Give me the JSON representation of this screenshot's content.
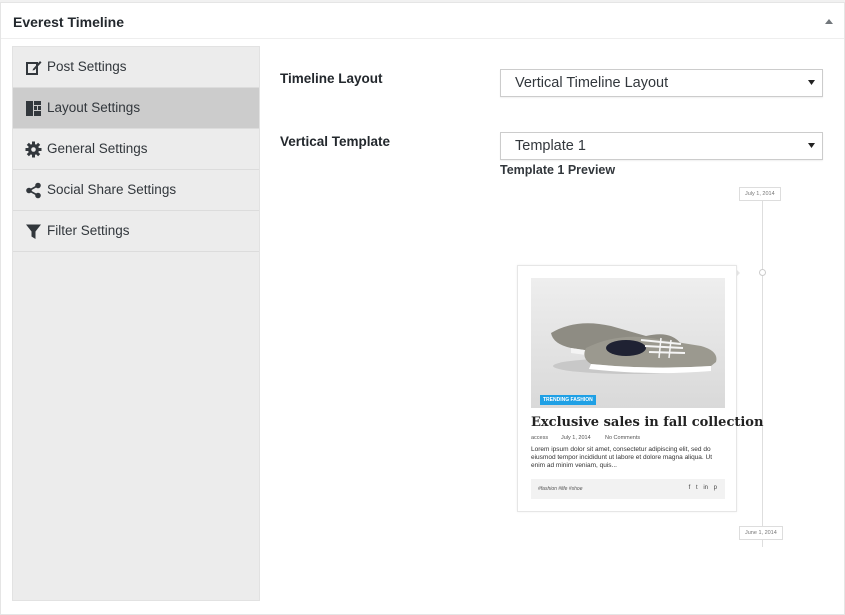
{
  "metabox": {
    "title": "Everest Timeline"
  },
  "sidebar": {
    "items": [
      {
        "label": "Post Settings",
        "icon": "edit-icon"
      },
      {
        "label": "Layout Settings",
        "icon": "layout-icon",
        "active": true
      },
      {
        "label": "General Settings",
        "icon": "gear-icon"
      },
      {
        "label": "Social Share Settings",
        "icon": "share-icon"
      },
      {
        "label": "Filter Settings",
        "icon": "filter-icon"
      }
    ]
  },
  "fields": {
    "timeline_layout": {
      "label": "Timeline Layout",
      "value": "Vertical Timeline Layout"
    },
    "vertical_template": {
      "label": "Vertical Template",
      "value": "Template 1"
    }
  },
  "preview": {
    "title": "Template 1 Preview",
    "date_top": "July 1, 2014",
    "date_bottom": "June 1, 2014",
    "card": {
      "tag": "TRENDING FASHION",
      "title": "Exclusive sales in fall collection",
      "author": "access",
      "date": "July 1, 2014",
      "comments": "No Comments",
      "excerpt": "Lorem ipsum dolor sit amet, consectetur adipiscing elit, sed do eiusmod tempor incididunt ut labore et dolore magna aliqua. Ut enim ad minim veniam, quis...",
      "tags": "#fashion  #life  #shoe",
      "social": [
        "f",
        "t",
        "in",
        "p"
      ]
    }
  },
  "colors": {
    "active_item_bg": "#cccccc",
    "sidebar_bg": "#ececec",
    "tag_bg": "#1fa0e5"
  }
}
